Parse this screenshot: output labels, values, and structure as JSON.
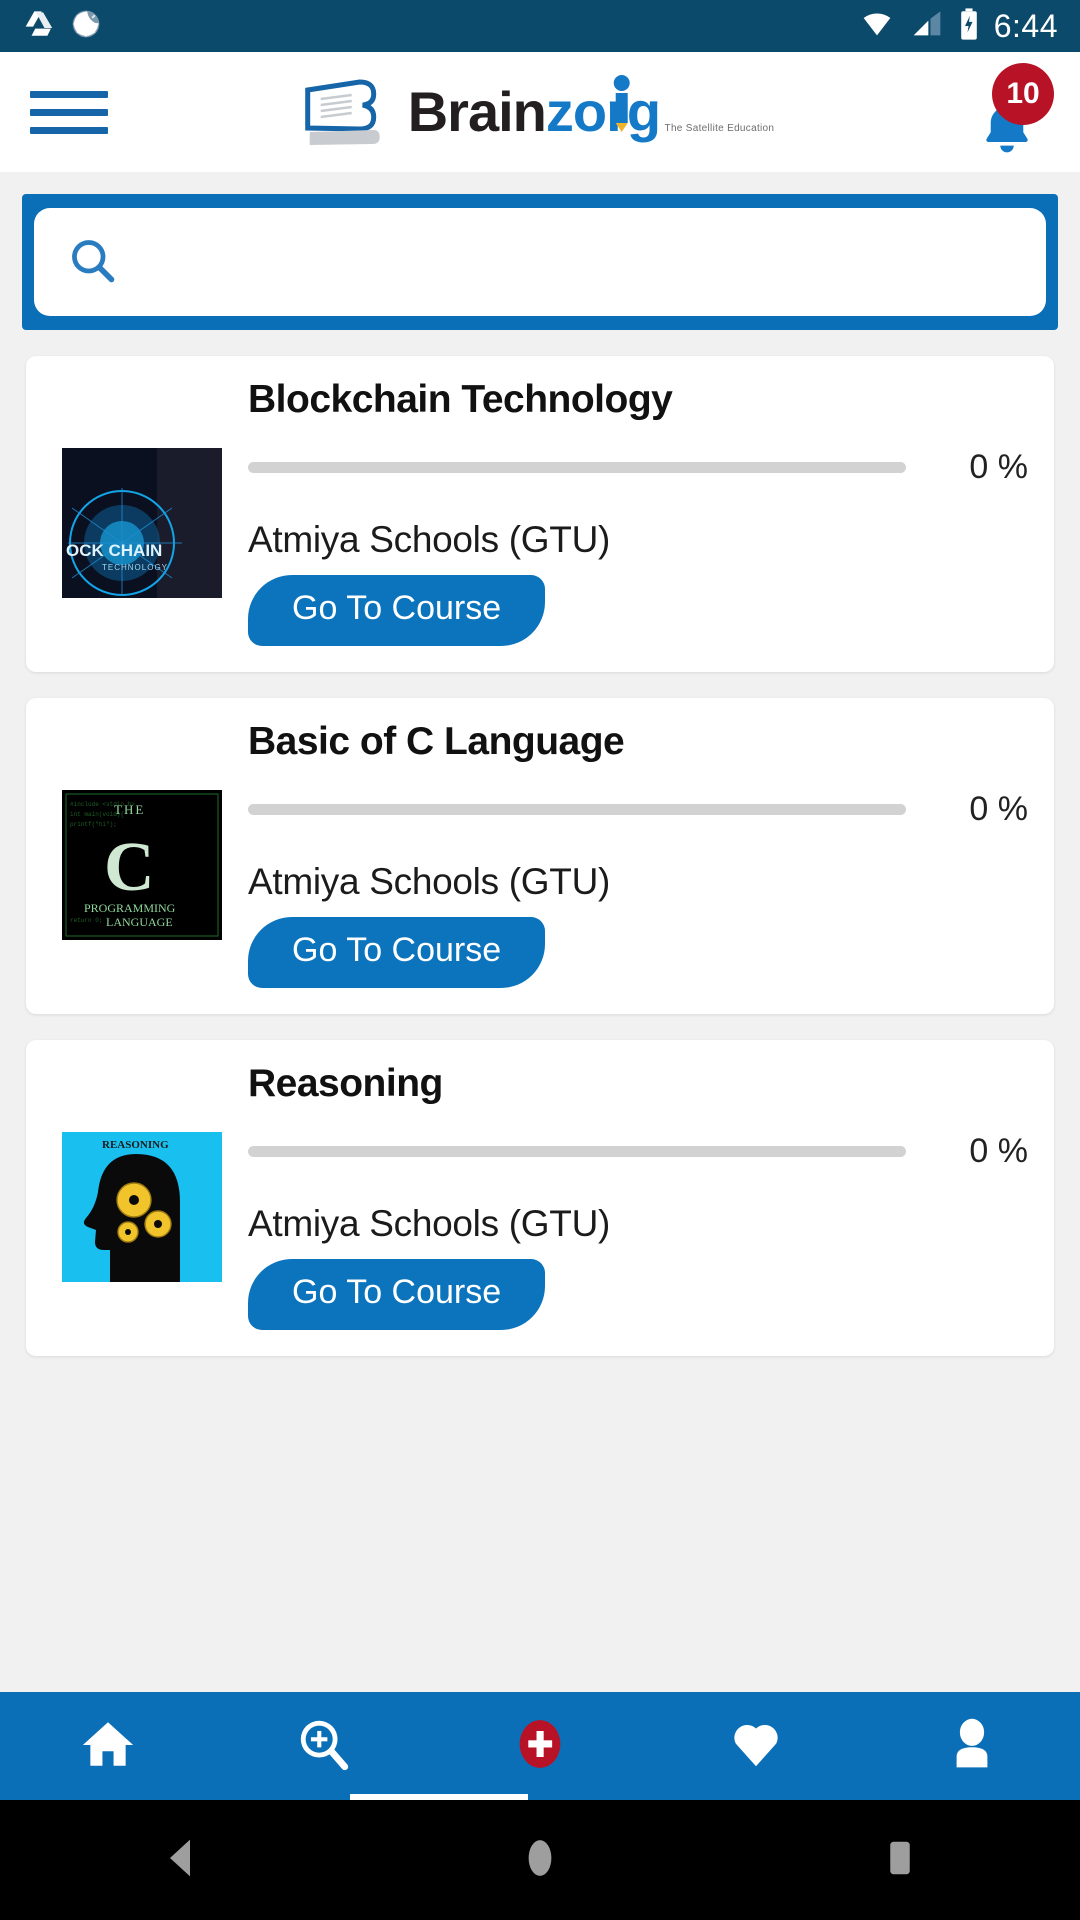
{
  "statusbar": {
    "time": "6:44",
    "icons": [
      "google-drive-icon",
      "sync-spinner-icon",
      "wifi-icon",
      "cellular-signal-icon",
      "battery-charging-icon"
    ]
  },
  "header": {
    "menu_icon": "hamburger-menu-icon",
    "logo": {
      "brand_first": "Brain",
      "brand_second": "zorg",
      "tagline": "The Satellite Education",
      "book_icon": "open-book-icon"
    },
    "notifications": {
      "icon": "bell-icon",
      "count": "10"
    }
  },
  "search": {
    "icon": "search-icon",
    "placeholder": "",
    "value": ""
  },
  "courses": [
    {
      "title": "Blockchain Technology",
      "progress_percent": 0,
      "progress_label": "0 %",
      "school": "Atmiya Schools (GTU)",
      "button_label": "Go To Course",
      "thumb_name": "blockchain-technology-thumbnail",
      "thumb_caption": "OCK CHAIN",
      "thumb_subcaption": "TECHNOLOGY"
    },
    {
      "title": "Basic of C Language",
      "progress_percent": 0,
      "progress_label": "0 %",
      "school": "Atmiya Schools (GTU)",
      "button_label": "Go To Course",
      "thumb_name": "c-language-thumbnail",
      "thumb_caption": "THE",
      "thumb_subcaption": "PROGRAMMING LANGUAGE"
    },
    {
      "title": "Reasoning",
      "progress_percent": 0,
      "progress_label": "0 %",
      "school": "Atmiya Schools (GTU)",
      "button_label": "Go To Course",
      "thumb_name": "reasoning-thumbnail",
      "thumb_caption": "REASONING",
      "thumb_subcaption": ""
    }
  ],
  "bottom_nav": {
    "items": [
      {
        "name": "home-icon",
        "label": "Home",
        "active": false
      },
      {
        "name": "search-zoom-icon",
        "label": "Search",
        "active": false
      },
      {
        "name": "add-circle-icon",
        "label": "Add",
        "active": true
      },
      {
        "name": "heart-icon",
        "label": "Favourites",
        "active": false
      },
      {
        "name": "person-icon",
        "label": "Profile",
        "active": false
      }
    ]
  },
  "system_nav": {
    "items": [
      "back-triangle-icon",
      "home-circle-icon",
      "recents-square-icon"
    ]
  },
  "colors": {
    "status_bar": "#0c4a6b",
    "accent_blue": "#0b6fb8",
    "brand_blue": "#1479c7",
    "badge_red": "#b81226",
    "add_red": "#b81226",
    "page_bg": "#f1f1f1",
    "card_bg": "#ffffff",
    "progress_track": "#d2d2d2"
  }
}
